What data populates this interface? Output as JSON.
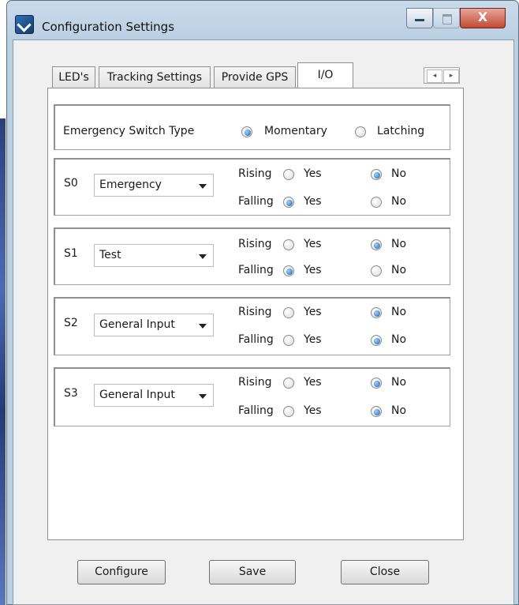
{
  "window": {
    "title": "Configuration Settings",
    "close_glyph": "X",
    "icon": "app-icon",
    "colors": {
      "close_button": "#c24a34",
      "radio_checked": "#1d5faa",
      "frame": "#bcd0e4"
    }
  },
  "tabs": [
    {
      "label": "LED's",
      "active": false
    },
    {
      "label": "Tracking Settings",
      "active": false
    },
    {
      "label": "Provide GPS",
      "active": false
    },
    {
      "label": "I/O",
      "active": true
    }
  ],
  "tab_scroll": {
    "left": "◂",
    "right": "▸"
  },
  "emergency": {
    "label": "Emergency Switch Type",
    "options": [
      {
        "label": "Momentary",
        "checked": true
      },
      {
        "label": "Latching",
        "checked": false
      }
    ]
  },
  "edge_labels": {
    "rising": "Rising",
    "falling": "Falling",
    "yes": "Yes",
    "no": "No"
  },
  "switches": [
    {
      "id": "S0",
      "value": "Emergency",
      "rising": "No",
      "falling": "Yes"
    },
    {
      "id": "S1",
      "value": "Test",
      "rising": "No",
      "falling": "Yes"
    },
    {
      "id": "S2",
      "value": "General Input",
      "rising": "No",
      "falling": "No"
    },
    {
      "id": "S3",
      "value": "General Input",
      "rising": "No",
      "falling": "No"
    }
  ],
  "buttons": {
    "configure": "Configure",
    "save": "Save",
    "close": "Close"
  }
}
